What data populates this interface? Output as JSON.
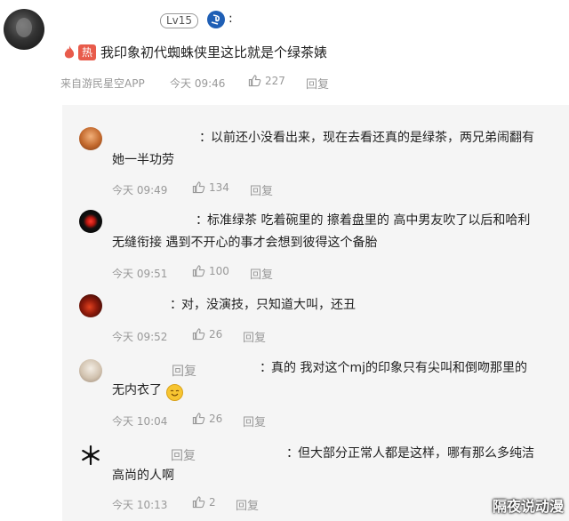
{
  "top_comment": {
    "level": "Lv15",
    "colon": ":",
    "hot_label": "热",
    "text": "我印象初代蜘蛛侠里这比就是个绿茶婊",
    "source": "来自游民星空APP",
    "time": "今天 09:46",
    "likes": "227",
    "reply": "回复"
  },
  "replies": [
    {
      "prefix": "：",
      "text_line1": "以前还小没看出来，现在去看还真的是绿茶，两兄弟闹翻有",
      "text_line2": "她一半功劳",
      "time": "今天 09:49",
      "likes": "134",
      "reply": "回复"
    },
    {
      "prefix": "：",
      "text_line1": "标准绿茶 吃着碗里的 擦着盘里的 高中男友吹了以后和哈利",
      "text_line2": "无缝衔接 遇到不开心的事才会想到彼得这个备胎",
      "time": "今天 09:51",
      "likes": "100",
      "reply": "回复"
    },
    {
      "prefix": "：",
      "text_line1": "对，没演技，只知道大叫，还丑",
      "time": "今天 09:52",
      "likes": "26",
      "reply": "回复"
    },
    {
      "inline_reply": "回复",
      "prefix": "：",
      "text_line1": "真的 我对这个mj的印象只有尖叫和倒吻那里的",
      "text_line2": "无内衣了",
      "emoji": "😊",
      "time": "今天 10:04",
      "likes": "26",
      "reply": "回复"
    },
    {
      "inline_reply": "回复",
      "prefix": "：",
      "text_line1": "但大部分正常人都是这样，哪有那么多纯洁",
      "text_line2": "高尚的人啊",
      "time": "今天 10:13",
      "likes": "2",
      "reply": "回复"
    }
  ],
  "watermark": "隔夜说动漫",
  "icons": [
    "thumb-up-icon",
    "hot-flame-icon",
    "playstation-icon"
  ]
}
